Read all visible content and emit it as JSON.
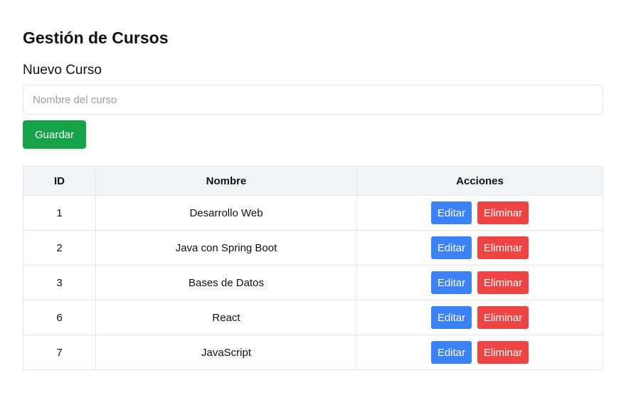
{
  "page": {
    "title": "Gestión de Cursos"
  },
  "form": {
    "heading": "Nuevo Curso",
    "input_placeholder": "Nombre del curso",
    "input_value": "",
    "save_label": "Guardar"
  },
  "table": {
    "headers": [
      "ID",
      "Nombre",
      "Acciones"
    ],
    "edit_label": "Editar",
    "delete_label": "Eliminar",
    "rows": [
      {
        "id": "1",
        "name": "Desarrollo Web"
      },
      {
        "id": "2",
        "name": "Java con Spring Boot"
      },
      {
        "id": "3",
        "name": "Bases de Datos"
      },
      {
        "id": "6",
        "name": "React"
      },
      {
        "id": "7",
        "name": "JavaScript"
      }
    ]
  },
  "colors": {
    "save_button": "#16a34a",
    "edit_button": "#3b82f6",
    "delete_button": "#ef4444",
    "header_background": "#f3f4f6"
  }
}
